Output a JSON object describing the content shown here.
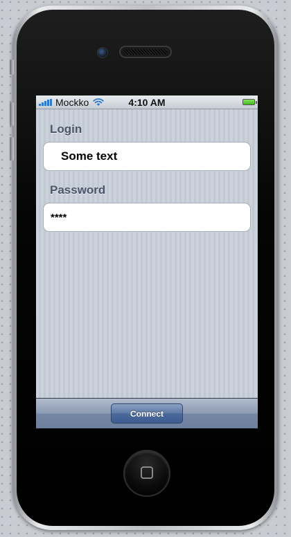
{
  "status_bar": {
    "carrier": "Mockko",
    "time": "4:10  AM",
    "signal_icon": "signal-bars-icon",
    "wifi_icon": "wifi-icon",
    "battery_icon": "battery-icon",
    "battery_color": "#5cc83a"
  },
  "form": {
    "login_label": "Login",
    "login_value": "Some text",
    "password_label": "Password",
    "password_value": "****"
  },
  "toolbar": {
    "connect_label": "Connect"
  },
  "colors": {
    "screen_background": "#c5ccd6",
    "label_color": "#4c566a",
    "toolbar_button": "#4a689a"
  }
}
